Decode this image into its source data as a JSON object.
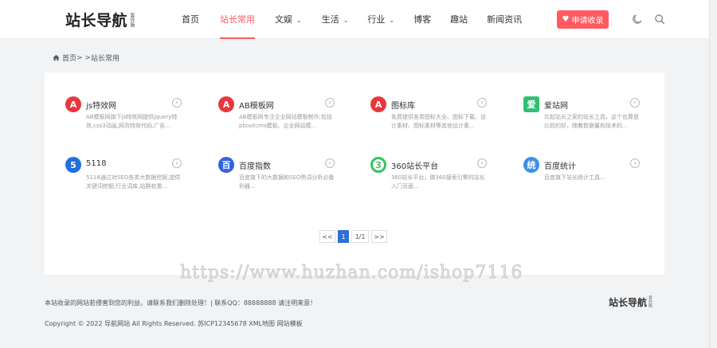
{
  "header": {
    "logo_main": "站长导航",
    "logo_sub": "复外版",
    "nav": [
      {
        "label": "首页",
        "active": false,
        "dropdown": false
      },
      {
        "label": "站长常用",
        "active": true,
        "dropdown": false
      },
      {
        "label": "文娱",
        "active": false,
        "dropdown": true
      },
      {
        "label": "生活",
        "active": false,
        "dropdown": true
      },
      {
        "label": "行业",
        "active": false,
        "dropdown": true
      },
      {
        "label": "博客",
        "active": false,
        "dropdown": false
      },
      {
        "label": "趣站",
        "active": false,
        "dropdown": false
      },
      {
        "label": "新闻资讯",
        "active": false,
        "dropdown": false
      }
    ],
    "apply_button": "申请收录",
    "icons": [
      "moon-icon",
      "search-icon"
    ]
  },
  "breadcrumb": {
    "home": "首页",
    "separator": " > > ",
    "current": "站长常用"
  },
  "sites": [
    {
      "name": "js特效网",
      "desc": "AB模板网旗下js特效网提供jquery特效,css3动画,网页特效代码,广告...",
      "icon": "A",
      "icon_color": "#e8373d"
    },
    {
      "name": "AB模板网",
      "desc": "AB模板网专注企业网站模板制作,包括pbootcms模板、企业网站模...",
      "icon": "A",
      "icon_color": "#e8373d"
    },
    {
      "name": "图标库",
      "desc": "免费提供各类图标大全、图标下载、设计素材、图标素材等其他设计素...",
      "icon": "A",
      "icon_color": "#e8373d"
    },
    {
      "name": "爱站网",
      "desc": "比起站长之家的站长工具，这个也算是比较的好，随着数据量和技术的...",
      "icon": "爱",
      "icon_color": "#2fbf71"
    },
    {
      "name": "5118",
      "desc": "5118通过对SEO各类大数据挖掘,提供关键词挖掘,行业词库,站群权重...",
      "icon": "5",
      "icon_color": "#1f6fe5"
    },
    {
      "name": "百度指数",
      "desc": "百度旗下的大数据和SEO热词分析必备利器...",
      "icon": "百",
      "icon_color": "#2f63e0"
    },
    {
      "name": "360站长平台",
      "desc": "360站长平台，做360搜索引擎的站长入门页面...",
      "icon": "3",
      "icon_color": "#35c35c"
    },
    {
      "name": "百度统计",
      "desc": "百度旗下站长统计工具...",
      "icon": "统",
      "icon_color": "#3d8fe6"
    }
  ],
  "pager": {
    "prev": "<<",
    "current": "1",
    "total": "1/1",
    "next": ">>"
  },
  "watermark": "https://www.huzhan.com/ishop7116",
  "footer": {
    "notice": "本站收录的网站若侵害到您的利益，请联系我们删除处理！| 联系QQ：88888888 请注明来意！",
    "copyright": "Copyright © 2022 导航网站 All Rights Reserved. 苏ICP12345678 XML地图 网站模板",
    "logo_main": "站长导航",
    "logo_sub": "复外版"
  },
  "colors": {
    "accent": "#ff5a5f",
    "pager_active": "#2f6fd6",
    "background": "#f1f3f5"
  }
}
